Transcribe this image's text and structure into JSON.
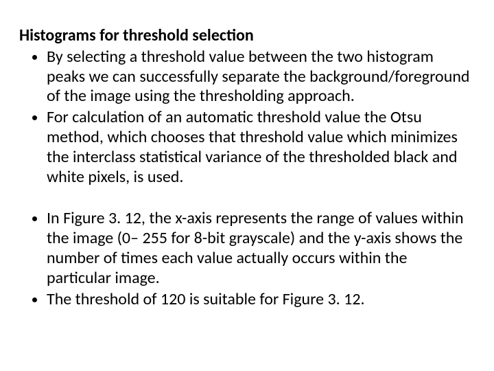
{
  "heading": "Histograms for threshold selection",
  "bullets_top": [
    "By selecting a threshold value between the two histogram peaks we can successfully separate the background/foreground of the image using the thresholding approach.",
    "For calculation of an automatic threshold value the Otsu method, which chooses that threshold value which minimizes the interclass statistical variance of the thresholded black and white pixels, is used."
  ],
  "bullets_bottom": [
    "In Figure 3. 12, the x-axis represents the range of values within the image (0– 255 for 8-bit grayscale) and the y-axis shows the number of times each value actually occurs within the particular image.",
    "The threshold of 120 is suitable for Figure 3. 12."
  ]
}
